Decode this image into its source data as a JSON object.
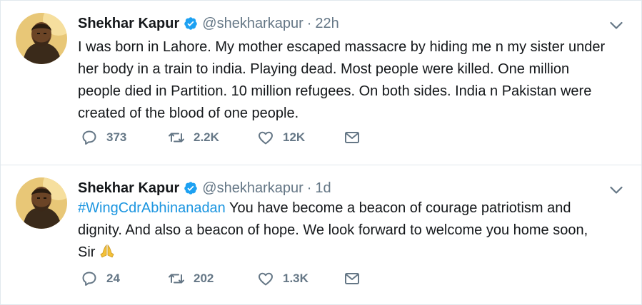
{
  "tweets": [
    {
      "author": {
        "name": "Shekhar Kapur",
        "handle": "@shekharkapur",
        "verified_icon": "verified-badge-icon",
        "avatar": "avatar-photo"
      },
      "time": "22h",
      "separator": "·",
      "text": "I was born in Lahore. My mother escaped massacre by hiding me n my sister under her body in a train to india. Playing dead. Most people were killed. One million people died in Partition. 10 million refugees. On both sides. India n Pakistan were created of the blood of one people.",
      "actions": {
        "replies": "373",
        "retweets": "2.2K",
        "likes": "12K"
      }
    },
    {
      "author": {
        "name": "Shekhar Kapur",
        "handle": "@shekharkapur",
        "verified_icon": "verified-badge-icon",
        "avatar": "avatar-photo"
      },
      "time": "1d",
      "separator": "·",
      "hashtag": "#WingCdrAbhinanadan",
      "text": " You have become a beacon of courage patriotism and dignity. And also a beacon of hope. We look forward to welcome you home soon, Sir",
      "emoji": "folded-hands-emoji",
      "actions": {
        "replies": "24",
        "retweets": "202",
        "likes": "1.3K"
      }
    }
  ],
  "colors": {
    "text": "#14171a",
    "secondary": "#657786",
    "link": "#1b95e0",
    "verified": "#1da1f2",
    "divider": "#e1e8ed"
  }
}
